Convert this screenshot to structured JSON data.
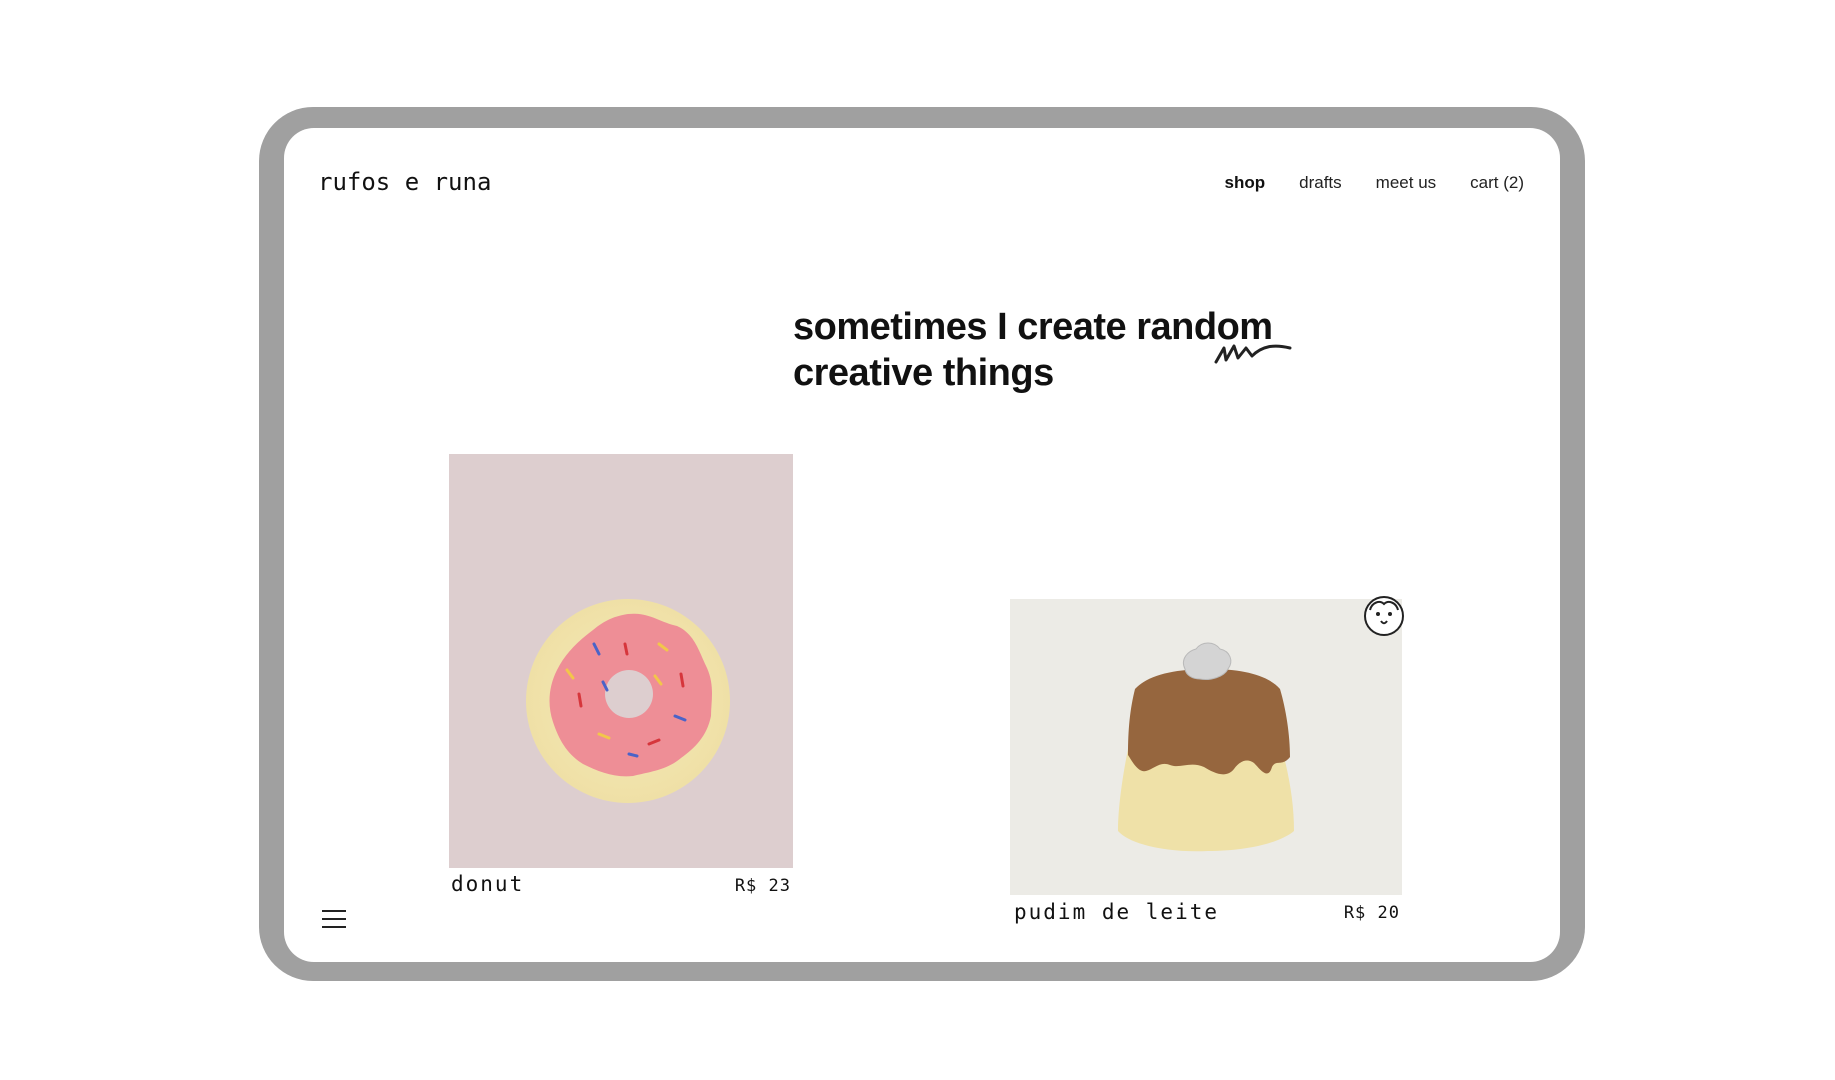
{
  "brand": {
    "logo": "rufos e runa"
  },
  "nav": {
    "items": [
      {
        "label": "shop",
        "active": true
      },
      {
        "label": "drafts",
        "active": false
      },
      {
        "label": "meet us",
        "active": false
      },
      {
        "label": "cart (2)",
        "active": false
      }
    ]
  },
  "hero": {
    "line1": "sometimes I create random",
    "line2": "creative things"
  },
  "products": [
    {
      "name": "donut",
      "price": "R$ 23",
      "background": "#ddcecf"
    },
    {
      "name": "pudim  de leite",
      "price": "R$ 20",
      "background": "#ecebe6"
    }
  ],
  "icons": {
    "menu": "hamburger-menu-icon",
    "squiggle": "squiggle-icon",
    "badge": "dog-face-icon"
  },
  "colors": {
    "frame": "#a0a0a0",
    "text": "#111111",
    "donut_bg": "#ddcecf",
    "pudim_bg": "#ecebe6"
  }
}
